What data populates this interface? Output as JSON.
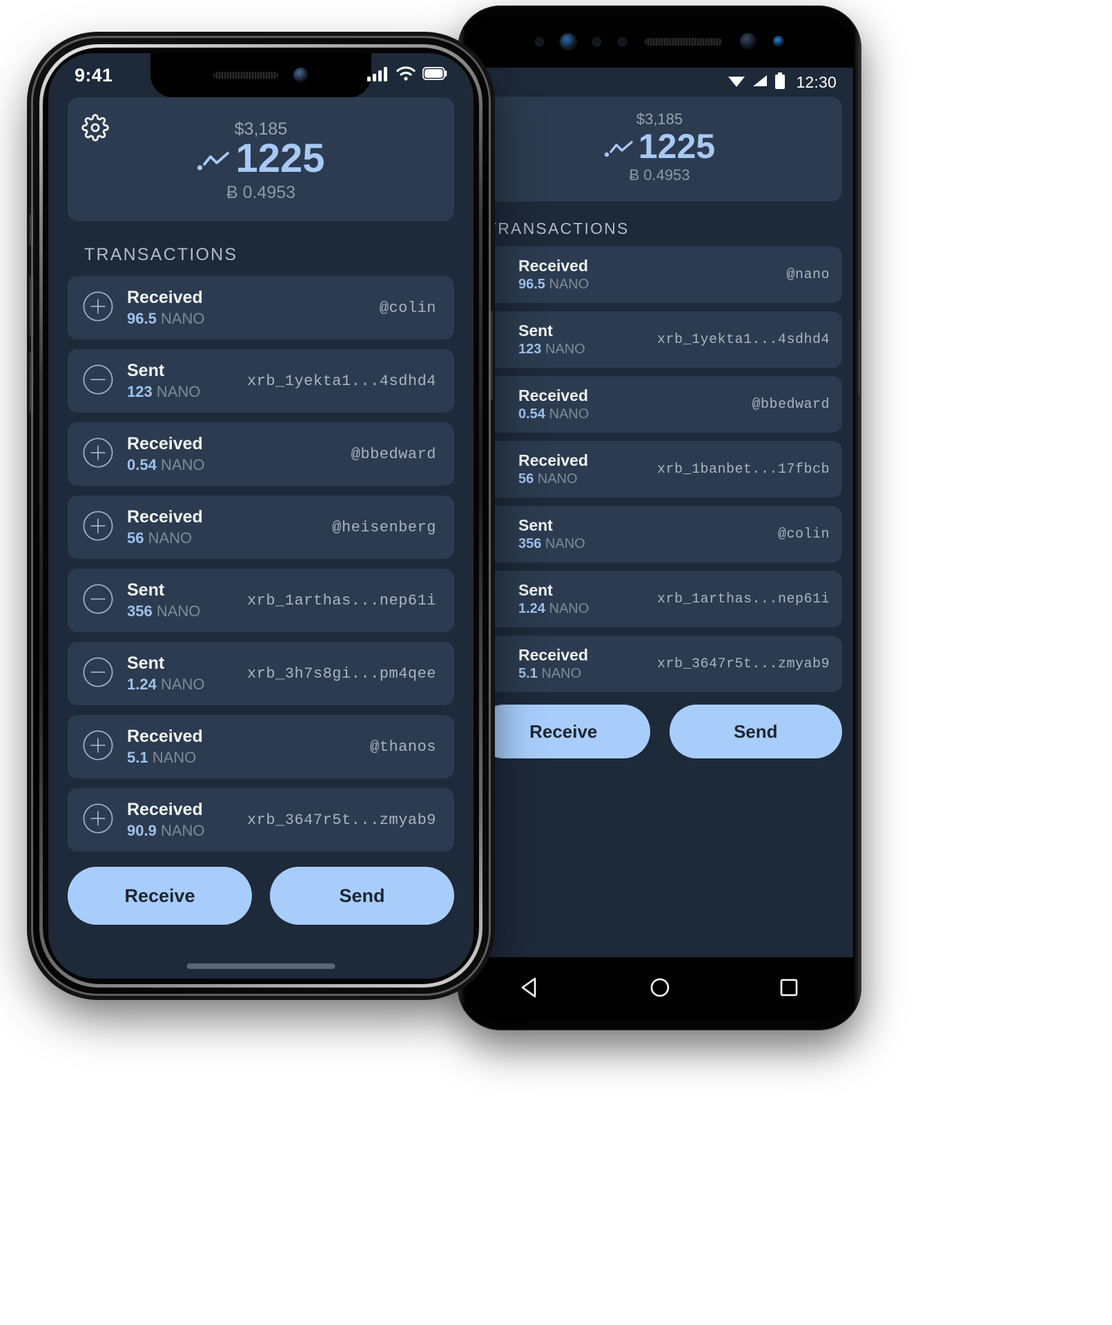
{
  "accent": "#a9cdfb",
  "screen_bg": "#1e2939",
  "card_bg": "#2c3b4f",
  "iphone": {
    "status": {
      "time": "9:41",
      "cellular_icon": "cellular-bars-icon",
      "wifi_icon": "wifi-icon",
      "battery_icon": "battery-icon"
    },
    "balance": {
      "settings_icon": "gear-icon",
      "sparkline_icon": "sparkline-icon",
      "fiat": "$3,185",
      "amount": "1225",
      "btc": "Ƀ 0.4953"
    },
    "transactions_label": "TRANSACTIONS",
    "transactions": [
      {
        "icon": "plus-circle-icon",
        "type": "Received",
        "amount": "96.5",
        "unit": "NANO",
        "address": "@colin"
      },
      {
        "icon": "minus-circle-icon",
        "type": "Sent",
        "amount": "123",
        "unit": "NANO",
        "address": "xrb_1yekta1...4sdhd4"
      },
      {
        "icon": "plus-circle-icon",
        "type": "Received",
        "amount": "0.54",
        "unit": "NANO",
        "address": "@bbedward"
      },
      {
        "icon": "plus-circle-icon",
        "type": "Received",
        "amount": "56",
        "unit": "NANO",
        "address": "@heisenberg"
      },
      {
        "icon": "minus-circle-icon",
        "type": "Sent",
        "amount": "356",
        "unit": "NANO",
        "address": "xrb_1arthas...nep61i"
      },
      {
        "icon": "minus-circle-icon",
        "type": "Sent",
        "amount": "1.24",
        "unit": "NANO",
        "address": "xrb_3h7s8gi...pm4qee"
      },
      {
        "icon": "plus-circle-icon",
        "type": "Received",
        "amount": "5.1",
        "unit": "NANO",
        "address": "@thanos"
      },
      {
        "icon": "plus-circle-icon",
        "type": "Received",
        "amount": "90.9",
        "unit": "NANO",
        "address": "xrb_3647r5t...zmyab9"
      }
    ],
    "actions": {
      "receive": "Receive",
      "send": "Send"
    }
  },
  "android": {
    "status": {
      "time": "12:30",
      "wifi_icon": "wifi-icon",
      "signal_icon": "signal-triangle-icon",
      "battery_icon": "battery-icon"
    },
    "balance": {
      "sparkline_icon": "sparkline-icon",
      "fiat": "$3,185",
      "amount": "1225",
      "btc": "Ƀ 0.4953"
    },
    "transactions_label": "TRANSACTIONS",
    "transactions": [
      {
        "icon": "plus-circle-icon",
        "type": "Received",
        "amount": "96.5",
        "unit": "NANO",
        "address": "@nano"
      },
      {
        "icon": "minus-circle-icon",
        "type": "Sent",
        "amount": "123",
        "unit": "NANO",
        "address": "xrb_1yekta1...4sdhd4"
      },
      {
        "icon": "plus-circle-icon",
        "type": "Received",
        "amount": "0.54",
        "unit": "NANO",
        "address": "@bbedward"
      },
      {
        "icon": "plus-circle-icon",
        "type": "Received",
        "amount": "56",
        "unit": "NANO",
        "address": "xrb_1banbet...17fbcb"
      },
      {
        "icon": "minus-circle-icon",
        "type": "Sent",
        "amount": "356",
        "unit": "NANO",
        "address": "@colin"
      },
      {
        "icon": "minus-circle-icon",
        "type": "Sent",
        "amount": "1.24",
        "unit": "NANO",
        "address": "xrb_1arthas...nep61i"
      },
      {
        "icon": "plus-circle-icon",
        "type": "Received",
        "amount": "5.1",
        "unit": "NANO",
        "address": "xrb_3647r5t...zmyab9"
      }
    ],
    "actions": {
      "receive": "Receive",
      "send": "Send"
    },
    "nav": {
      "back_icon": "nav-back-triangle-icon",
      "home_icon": "nav-home-circle-icon",
      "recents_icon": "nav-recents-square-icon"
    }
  }
}
